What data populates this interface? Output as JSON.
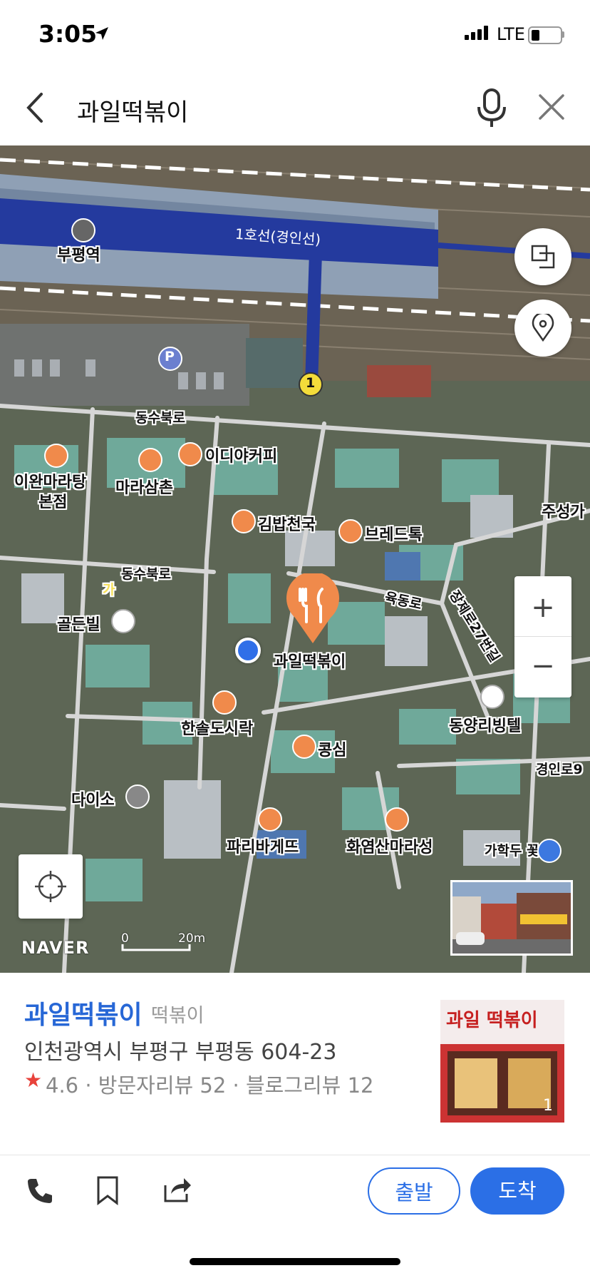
{
  "status": {
    "time": "3:05",
    "network": "LTE"
  },
  "search": {
    "query": "과일떡볶이"
  },
  "map": {
    "transit_line": "1호선(경인선)",
    "station": "부평역",
    "exit_number": "1",
    "parking": "P",
    "labels": {
      "dongsu_bukro_1": "동수북로",
      "dongsu_bukro_2": "동수북로",
      "ediya": "이디야커피",
      "iwan_1": "이완마라탕",
      "iwan_2": "본점",
      "marasamchon": "마라삼촌",
      "kimbap": "김밥천국",
      "bread": "브레드톡",
      "ga": "가",
      "yukdong": "육동로",
      "jangjegil": "장제로27번길",
      "golden": "골든빌",
      "target": "과일떡볶이",
      "hansol": "한솔도시락",
      "dongyang": "동양리빙텔",
      "kongsim": "콩심",
      "gyeongin_right": "경인로9",
      "daiso": "다이소",
      "paris": "파리바게뜨",
      "hwayeom": "화염산마라성",
      "right_edge_top": "주성가",
      "right_edge_bottom": "가학두 꽃하"
    },
    "brand": "NAVER",
    "scale_zero": "0",
    "scale_label": "20m",
    "zoom_in": "+",
    "zoom_out": "−"
  },
  "place": {
    "name": "과일떡볶이",
    "category": "떡볶이",
    "address": "인천광역시 부평구 부평동 604-23",
    "rating": "4.6 · 방문자리뷰 52 · 블로그리뷰 12",
    "photo_count": "1",
    "sign_text": "과일 떡볶이"
  },
  "actions": {
    "depart": "출발",
    "arrive": "도착"
  },
  "colors": {
    "accent": "#2b6fe6",
    "place_name": "#2767d6",
    "poi_orange": "#f08a4b",
    "subway_line": "#243a9e"
  }
}
